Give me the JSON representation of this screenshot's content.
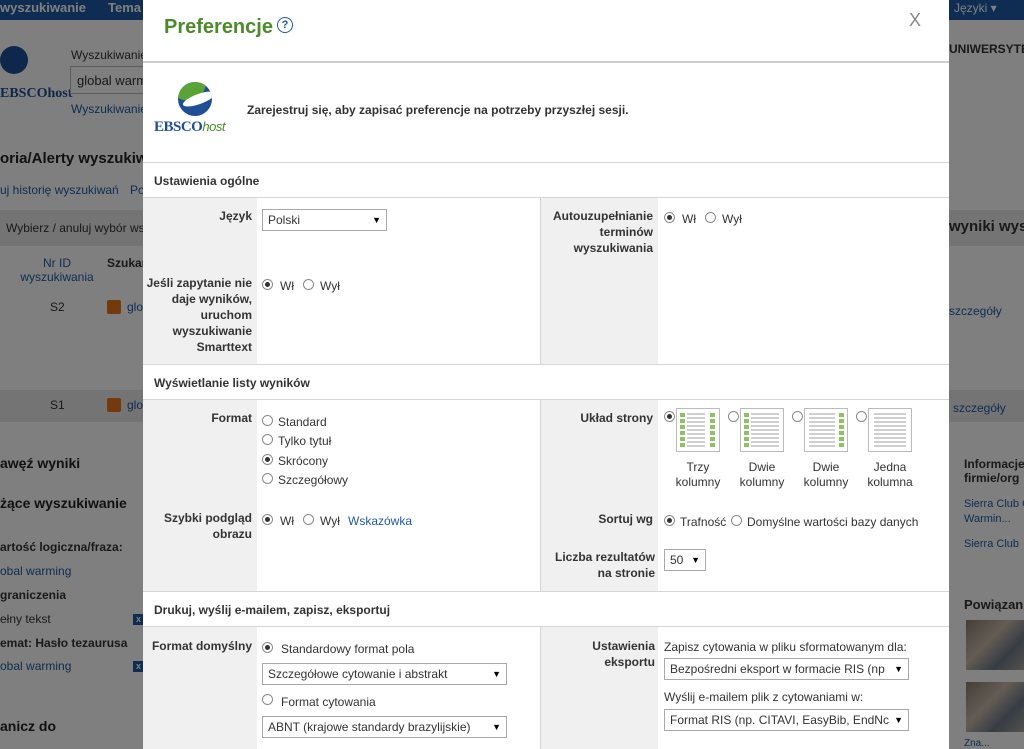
{
  "background": {
    "nav": [
      "wyszukiwanie",
      "Tema",
      "Języki ▾"
    ],
    "search_label": "Wyszukiwanie",
    "search_value": "global warming",
    "search_link": "Wyszukiwanie",
    "logo": "EBSCOhost",
    "institution": "UNIWERSYTET",
    "history_title": "oria/Alerty wyszukiw",
    "history_link": "uj historię wyszukiwań",
    "history_link2": "Po",
    "select_all": "Wybierz / anuluj wybór ws",
    "results_header": "wyniki wys",
    "col_id": "Nr ID wyszukiwania",
    "col_search": "Szukan",
    "rows": [
      {
        "id": "S2",
        "term": "glo",
        "details": "szczegóły"
      },
      {
        "id": "S1",
        "term": "glo",
        "details": "szczegóły"
      }
    ],
    "narrow": "awęź wyniki",
    "current_search": "żące wyszukiwanie",
    "boolean": "artość logiczna/fraza:",
    "boolean_value": "obal warming",
    "limits": "graniczenia",
    "fulltext": "ełny tekst",
    "thesaurus": "emat: Hasło tezaurusa",
    "thesaurus_value": "obal warming",
    "limit_to": "anicz do",
    "info": "Informacje firmie/org",
    "sierra1": "Sierra Club C",
    "sierra1b": "Warmin...",
    "sierra2": "Sierra Club",
    "related": "Powiązan",
    "more_images": "Zna..."
  },
  "modal": {
    "title": "Preferencje",
    "help_icon": "?",
    "close": "X",
    "logo_main": "EBSCO",
    "logo_sub": "host",
    "register_text": "Zarejestruj się, aby zapisać preferencje na potrzeby przyszłej sesji.",
    "general": {
      "heading": "Ustawienia ogólne",
      "language_label": "Język",
      "language_value": "Polski",
      "autocomplete_label": "Autouzupełnianie terminów wyszukiwania",
      "on": "Wł",
      "off": "Wył",
      "smarttext_label": "Jeśli zapytanie nie daje wyników, uruchom wyszukiwanie Smarttext"
    },
    "results": {
      "heading": "Wyświetlanie listy wyników",
      "format_label": "Format",
      "formats": [
        "Standard",
        "Tylko tytuł",
        "Skrócony",
        "Szczegółowy"
      ],
      "selected_format": "Skrócony",
      "layout_label": "Układ strony",
      "layouts": [
        {
          "line1": "Trzy",
          "line2": "kolumny"
        },
        {
          "line1": "Dwie",
          "line2": "kolumny"
        },
        {
          "line1": "Dwie",
          "line2": "kolumny"
        },
        {
          "line1": "Jedna",
          "line2": "kolumna"
        }
      ],
      "preview_label": "Szybki podgląd obrazu",
      "hint": "Wskazówka",
      "sort_label": "Sortuj wg",
      "sort_relevance": "Trafność",
      "sort_default": "Domyślne wartości bazy danych",
      "count_label": "Liczba rezultatów na stronie",
      "count_value": "50"
    },
    "print": {
      "heading": "Drukuj, wyślij e-mailem, zapisz, eksportuj",
      "default_format_label": "Format domyślny",
      "standard_field_format": "Standardowy format pola",
      "standard_select": "Szczegółowe cytowanie i abstrakt",
      "citation_format": "Format cytowania",
      "citation_select": "ABNT (krajowe standardy brazylijskie)",
      "export_label": "Ustawienia eksportu",
      "save_citations": "Zapisz cytowania w pliku sformatowanym dla:",
      "save_select": "Bezpośredni eksport w formacie RIS (np",
      "email_citations": "Wyślij e-mailem plik z cytowaniami w:",
      "email_select": "Format RIS (np. CITAVI, EasyBib, EndNc"
    }
  }
}
